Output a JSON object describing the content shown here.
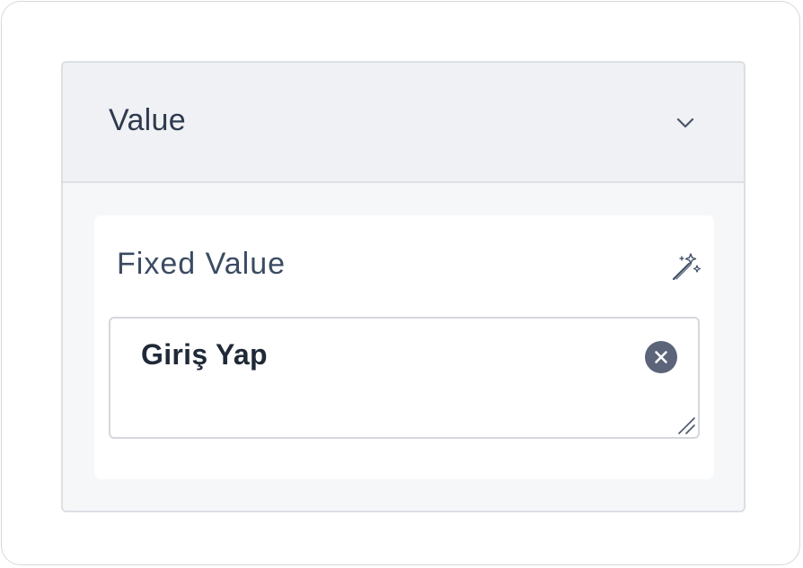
{
  "panel": {
    "title": "Value",
    "expand_icon": "chevron-down-icon"
  },
  "field": {
    "label": "Fixed Value",
    "action_icon": "magic-wand-icon",
    "value": "Giriş Yap",
    "clear_icon": "clear-circle-icon",
    "resize_icon": "resize-handle-icon"
  },
  "colors": {
    "header_bg": "#eff1f4",
    "panel_bg": "#f6f7f9",
    "title_text": "#2e3a4e",
    "clear_button": "#5b6478"
  }
}
